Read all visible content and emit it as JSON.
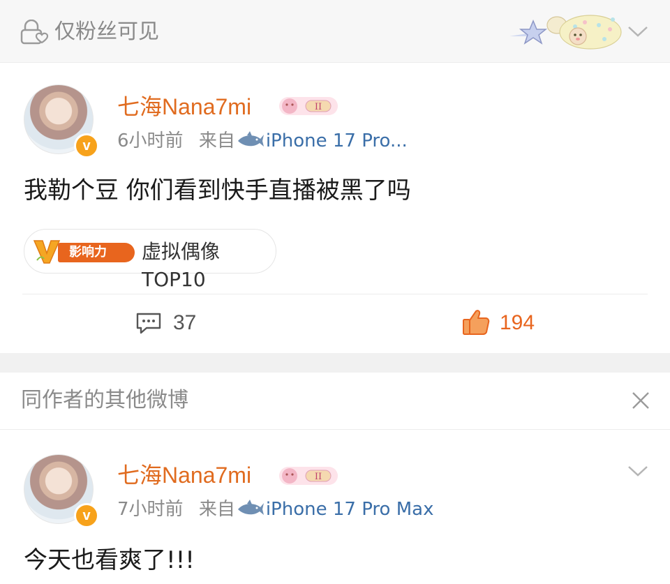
{
  "visibility": {
    "label": "仅粉丝可见",
    "icon": "lock-icon"
  },
  "post": {
    "author": "七海Nana7mi",
    "time": "6小时前",
    "from_label": "来自",
    "source": "iPhone 17 Pro...",
    "text": "我勒个豆 你们看到快手直播被黑了吗",
    "topic": {
      "badge": "影响力",
      "label": "虚拟偶像TOP10"
    },
    "comments": "37",
    "likes": "194"
  },
  "related": {
    "title": "同作者的其他微博",
    "post": {
      "author": "七海Nana7mi",
      "time": "7小时前",
      "from_label": "来自",
      "source": "iPhone 17 Pro Max",
      "text": "今天也看爽了!!!"
    }
  },
  "colors": {
    "accent": "#e8651e",
    "username": "#e06b1f",
    "source_link": "#3a6ea8",
    "muted": "#8a8a8a"
  }
}
